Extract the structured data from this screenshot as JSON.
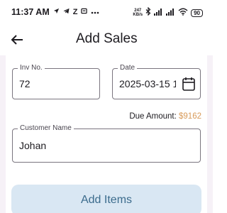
{
  "status_bar": {
    "time": "11:37 AM",
    "left_icons": [
      "location-arrow-icon",
      "telegram-icon",
      "z-app-icon",
      "more-dots-icon"
    ],
    "net_speed_value": "247",
    "net_speed_unit": "KB/s",
    "battery": "90"
  },
  "app_bar": {
    "title": "Add Sales"
  },
  "form": {
    "inv_no": {
      "label": "Inv No.",
      "value": "72"
    },
    "date": {
      "label": "Date",
      "value": "2025-03-15 1"
    },
    "due_amount": {
      "label": "Due Amount:",
      "value": "$9162"
    },
    "customer_name": {
      "label": "Customer Name",
      "value": "Johan"
    }
  },
  "actions": {
    "add_items_label": "Add Items"
  },
  "colors": {
    "due_amount": "#d89a59",
    "button_bg": "#d9e7f3",
    "button_text": "#3b6b8c",
    "content_bg": "#f6f1f7"
  }
}
